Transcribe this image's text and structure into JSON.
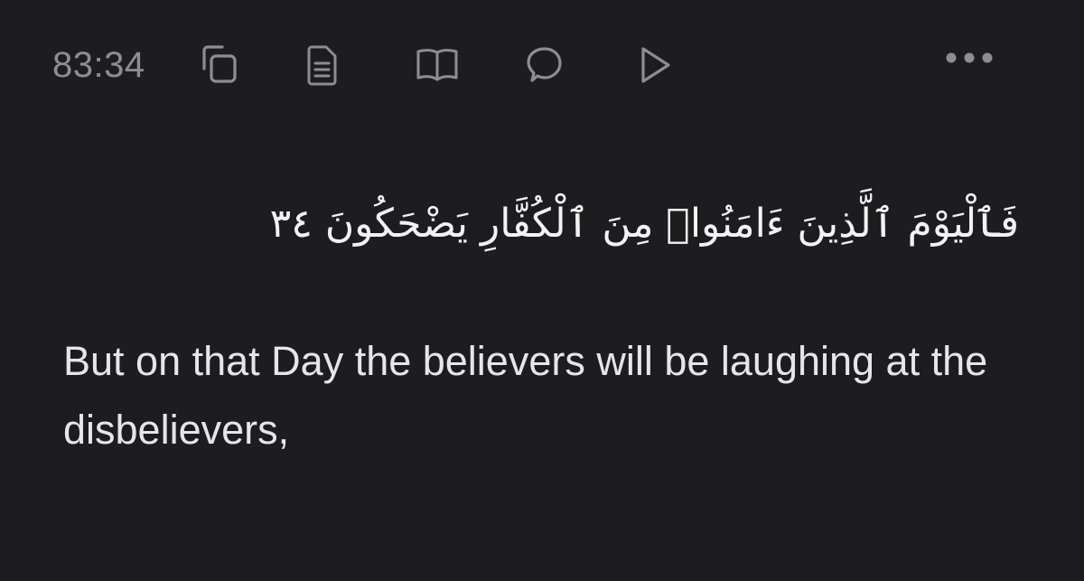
{
  "toolbar": {
    "verse_ref": "83:34",
    "buttons": [
      {
        "icon": "copy-icon"
      },
      {
        "icon": "tafsir-document-icon"
      },
      {
        "icon": "open-book-icon"
      },
      {
        "icon": "comment-bubble-icon"
      },
      {
        "icon": "play-icon"
      },
      {
        "icon": "more-options-icon"
      }
    ]
  },
  "verse": {
    "arabic": "فَٱلْيَوْمَ ٱلَّذِينَ ءَامَنُوا۟ مِنَ ٱلْكُفَّارِ يَضْحَكُونَ ٣٤",
    "translation": "But on that Day the believers will be laughing at the disbelievers,"
  },
  "colors": {
    "background": "#1d1d20",
    "icon": "#8e8e92",
    "text": "#e6e6e8"
  }
}
